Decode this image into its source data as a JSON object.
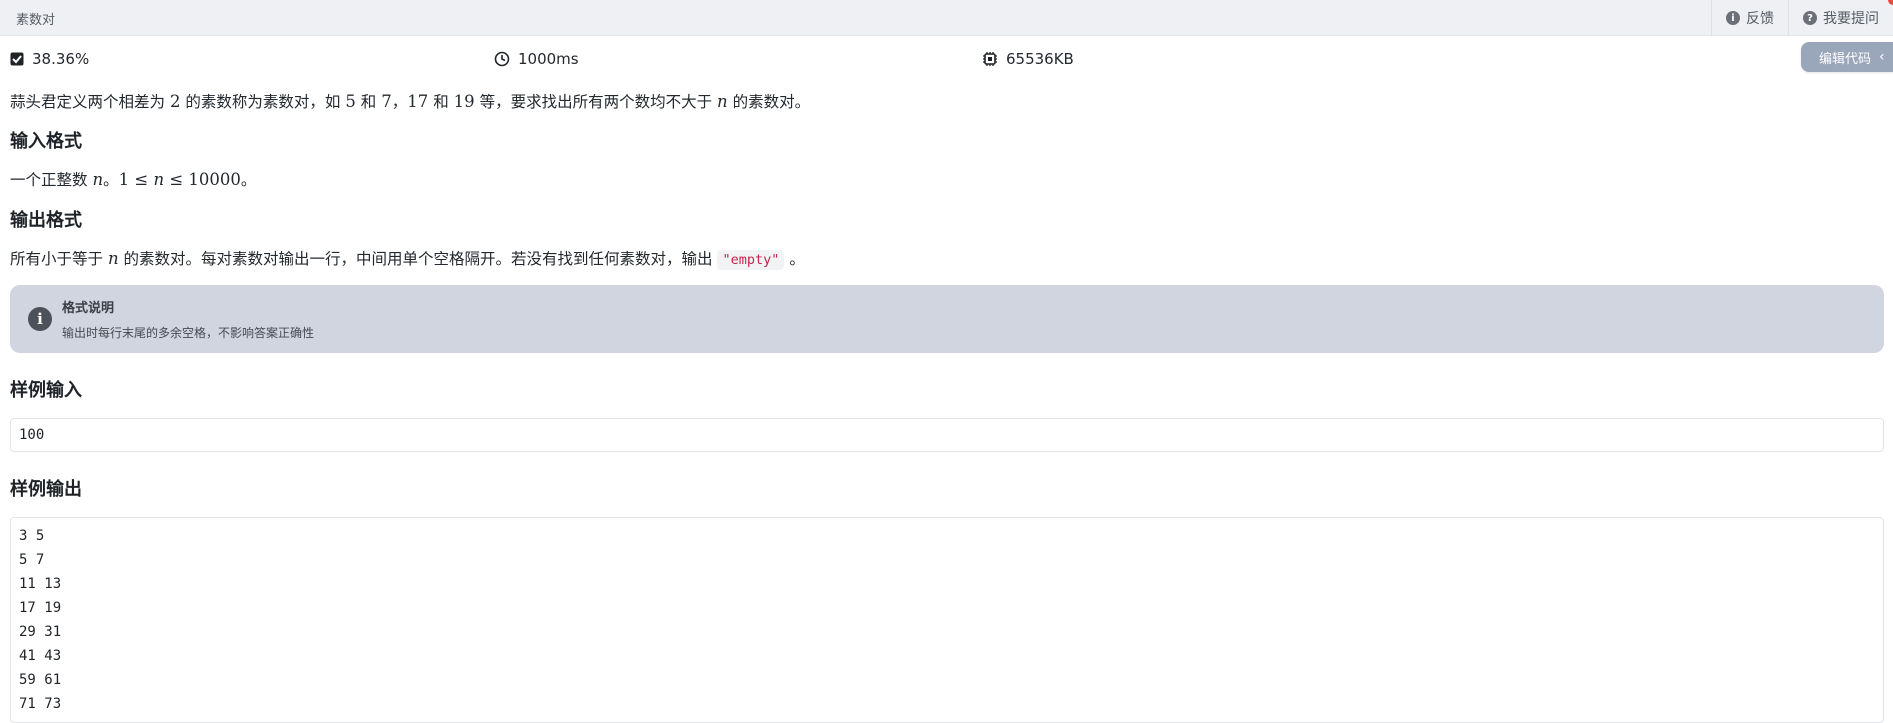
{
  "topbar": {
    "title": "素数对",
    "feedback_label": "反馈",
    "ask_label": "我要提问"
  },
  "stats": {
    "pass_rate": "38.36%",
    "time_limit": "1000ms",
    "memory_limit": "65536KB"
  },
  "edit_button": {
    "label": "编辑代码"
  },
  "description": {
    "p1": "蒜头君定义两个相差为",
    "m_2": "2",
    "p2": "的素数称为素数对，如",
    "m_5": "5",
    "p3": "和",
    "m_7": "7",
    "p4": "，",
    "m_17": "17",
    "p5": "和",
    "m_19": "19",
    "p6": "等，要求找出所有两个数均不大于",
    "m_n": "n",
    "p7": "的素数对。"
  },
  "input_format": {
    "heading": "输入格式",
    "t1": "一个正整数",
    "m_n": "n",
    "t2": "。",
    "m_range": "1 ≤ ",
    "m_n2": "n",
    "m_range2": " ≤ 10000",
    "t3": "。"
  },
  "output_format": {
    "heading": "输出格式",
    "t1": "所有小于等于",
    "m_n": "n",
    "t2": "的素数对。每对素数对输出一行，中间用单个空格隔开。若没有找到任何素数对，输出",
    "code": "\"empty\"",
    "t3": "。"
  },
  "notice": {
    "title": "格式说明",
    "text": "输出时每行末尾的多余空格，不影响答案正确性"
  },
  "sample_input": {
    "heading": "样例输入",
    "lines": [
      "100"
    ]
  },
  "sample_output": {
    "heading": "样例输出",
    "lines": [
      "3 5",
      "5 7",
      "11 13",
      "17 19",
      "29 31",
      "41 43",
      "59 61",
      "71 73"
    ]
  }
}
